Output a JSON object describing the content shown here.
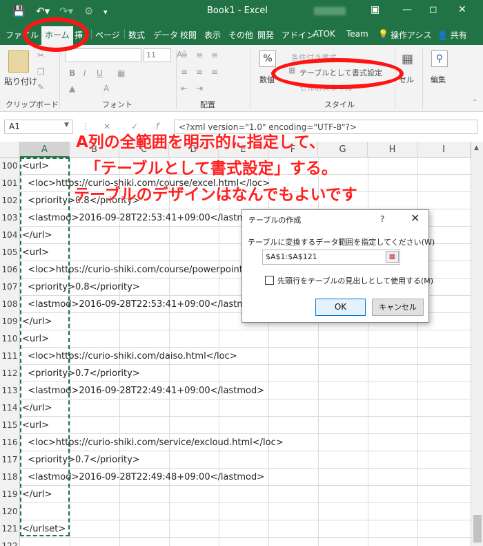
{
  "window": {
    "title": "Book1 - Excel"
  },
  "title_bar": {
    "icons": [
      "save-icon",
      "undo-icon",
      "redo-icon",
      "customize-icon"
    ]
  },
  "ribbon_tabs": [
    "ファイル",
    "ホーム",
    "挿入",
    "ページ",
    "数式",
    "データ",
    "校閲",
    "表示",
    "その他",
    "開発",
    "アドイン",
    "ATOK",
    "Team"
  ],
  "ribbon_tabs_active": "ホーム",
  "tell_me": "操作アシス",
  "share": "共有",
  "ribbon": {
    "clipboard": {
      "paste": "貼り付け",
      "label": "クリップボード"
    },
    "font": {
      "size": "11",
      "label": "フォント",
      "bold": "B",
      "italic": "I",
      "underline": "U"
    },
    "alignment": {
      "label": "配置"
    },
    "number": {
      "label": "数値",
      "percent": "%"
    },
    "styles": {
      "conditional": "条件付き書式",
      "format_as_table": "テーブルとして書式設定",
      "cell_styles": "セルのスタイル",
      "label": "スタイル"
    },
    "cells": {
      "label": "セル"
    },
    "editing": {
      "label": "編集"
    }
  },
  "formula_bar": {
    "name_box": "A1",
    "formula": "<?xml version=\"1.0\" encoding=\"UTF-8\"?>"
  },
  "columns": [
    "A",
    "B",
    "C",
    "D",
    "E",
    "F",
    "G",
    "H",
    "I"
  ],
  "rows": [
    {
      "num": "100",
      "text": "<url>"
    },
    {
      "num": "101",
      "text": "  <loc>https://curio-shiki.com/course/excel.html</loc>"
    },
    {
      "num": "102",
      "text": "  <priority>0.8</priority>"
    },
    {
      "num": "103",
      "text": "  <lastmod>2016-09-28T22:53:41+09:00</lastmod>"
    },
    {
      "num": "104",
      "text": "</url>"
    },
    {
      "num": "105",
      "text": "<url>"
    },
    {
      "num": "106",
      "text": "  <loc>https://curio-shiki.com/course/powerpoint.html</loc>"
    },
    {
      "num": "107",
      "text": "  <priority>0.8</priority>"
    },
    {
      "num": "108",
      "text": "  <lastmod>2016-09-28T22:53:41+09:00</lastmod>"
    },
    {
      "num": "109",
      "text": "</url>"
    },
    {
      "num": "110",
      "text": "<url>"
    },
    {
      "num": "111",
      "text": "  <loc>https://curio-shiki.com/daiso.html</loc>"
    },
    {
      "num": "112",
      "text": "  <priority>0.7</priority>"
    },
    {
      "num": "113",
      "text": "  <lastmod>2016-09-28T22:49:41+09:00</lastmod>"
    },
    {
      "num": "114",
      "text": "</url>"
    },
    {
      "num": "115",
      "text": "<url>"
    },
    {
      "num": "116",
      "text": "  <loc>https://curio-shiki.com/service/excloud.html</loc>"
    },
    {
      "num": "117",
      "text": "  <priority>0.7</priority>"
    },
    {
      "num": "118",
      "text": "  <lastmod>2016-09-28T22:49:48+09:00</lastmod>"
    },
    {
      "num": "119",
      "text": "</url>"
    },
    {
      "num": "120",
      "text": ""
    },
    {
      "num": "121",
      "text": "</urlset>"
    },
    {
      "num": "122",
      "text": ""
    }
  ],
  "dialog": {
    "title": "テーブルの作成",
    "help": "?",
    "prompt": "テーブルに変換するデータ範囲を指定してください(W)",
    "range": "$A$1:$A$121",
    "checkbox_label": "先頭行をテーブルの見出しとして使用する(M)",
    "checkbox_checked": false,
    "ok": "OK",
    "cancel": "キャンセル"
  },
  "annotations": {
    "line1": "A列の全範囲を明示的に指定して、",
    "line2": "「テーブルとして書式設定」する。",
    "line3": "テーブルのデザインはなんでもよいです",
    "color": "#ff1f1f"
  }
}
